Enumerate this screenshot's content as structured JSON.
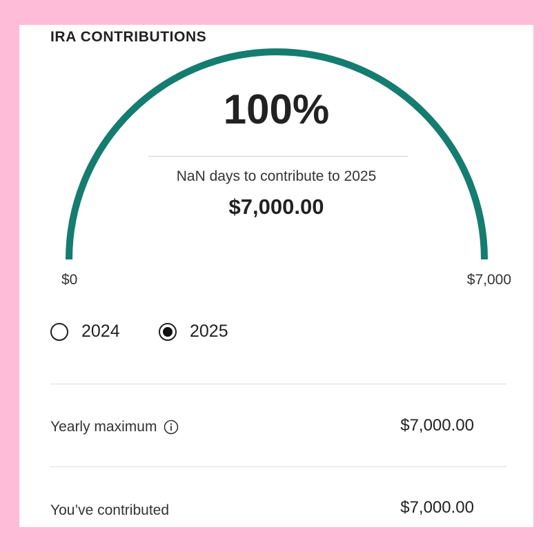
{
  "section": {
    "title": "IRA CONTRIBUTIONS"
  },
  "gauge": {
    "percent_label": "100%",
    "progress_fraction": 1.0,
    "days_text": "NaN days to contribute to 2025",
    "amount": "$7,000.00",
    "min_label": "$0",
    "max_label": "$7,000",
    "color": "#147d70"
  },
  "years": [
    {
      "label": "2024",
      "selected": false
    },
    {
      "label": "2025",
      "selected": true
    }
  ],
  "rows": [
    {
      "label": "Yearly maximum",
      "value": "$7,000.00",
      "icon": "info-icon"
    },
    {
      "label": "You’ve contributed",
      "value": "$7,000.00"
    }
  ]
}
